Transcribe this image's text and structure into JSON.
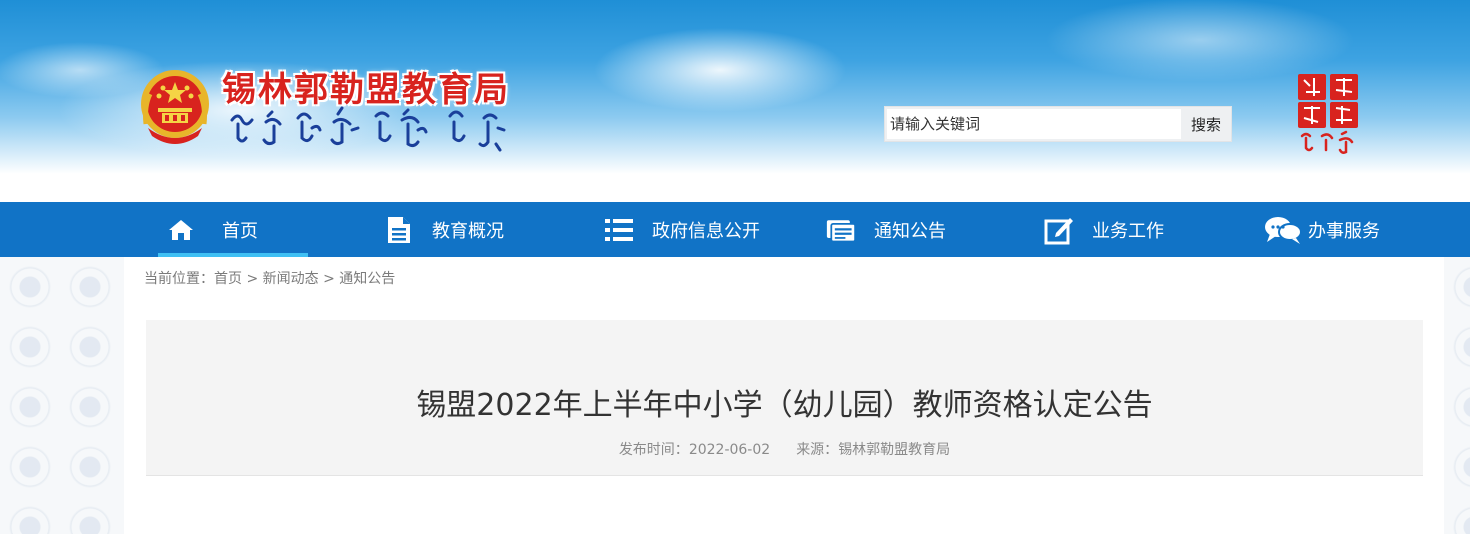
{
  "header": {
    "site_title": "锡林郭勒盟教育局",
    "emblem_icon": "national-emblem-icon",
    "seal_icon": "seal-logo-icon",
    "title_color": "#d8231e"
  },
  "search": {
    "placeholder": "请输入关键词",
    "button_label": "搜索"
  },
  "nav": {
    "background": "#1173c6",
    "items": [
      {
        "label": "首页",
        "icon": "home-icon",
        "active": true
      },
      {
        "label": "教育概况",
        "icon": "document-icon"
      },
      {
        "label": "政府信息公开",
        "icon": "list-icon"
      },
      {
        "label": "通知公告",
        "icon": "notice-icon"
      },
      {
        "label": "业务工作",
        "icon": "edit-icon"
      },
      {
        "label": "办事服务",
        "icon": "chat-icon"
      }
    ]
  },
  "breadcrumb": {
    "prefix": "当前位置：",
    "items": [
      "首页",
      "新闻动态",
      "通知公告"
    ],
    "separator": ">"
  },
  "article": {
    "title": "锡盟2022年上半年中小学（幼儿园）教师资格认定公告",
    "date_label": "发布时间：",
    "date": "2022-06-02",
    "source_label": "来源：",
    "source": "锡林郭勒盟教育局"
  }
}
